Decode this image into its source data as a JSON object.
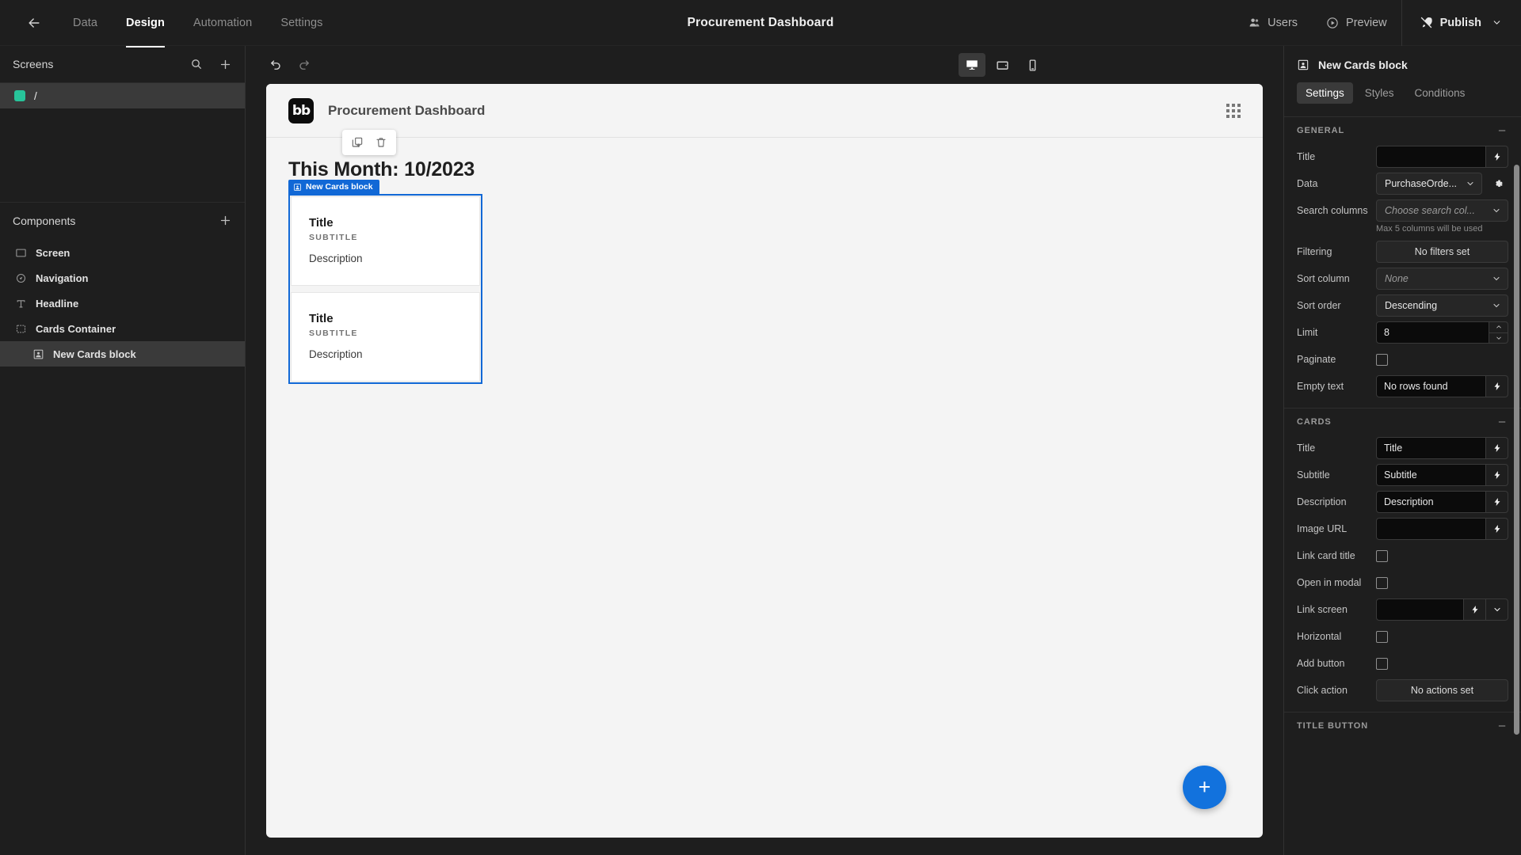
{
  "topbar": {
    "back_icon": "arrow-left-icon",
    "tabs": [
      {
        "label": "Data",
        "active": false
      },
      {
        "label": "Design",
        "active": true
      },
      {
        "label": "Automation",
        "active": false
      },
      {
        "label": "Settings",
        "active": false
      }
    ],
    "title": "Procurement Dashboard",
    "users_label": "Users",
    "preview_label": "Preview",
    "publish_label": "Publish"
  },
  "screens_panel": {
    "title": "Screens",
    "search_icon": "search-icon",
    "add_icon": "plus-icon",
    "items": [
      {
        "label": "/",
        "color": "#27c49a",
        "selected": true
      }
    ]
  },
  "components_panel": {
    "title": "Components",
    "add_icon": "plus-icon",
    "items": [
      {
        "label": "Screen",
        "icon": "screen-icon",
        "indent": false,
        "selected": false
      },
      {
        "label": "Navigation",
        "icon": "navigation-icon",
        "indent": false,
        "selected": false
      },
      {
        "label": "Headline",
        "icon": "text-icon",
        "indent": false,
        "selected": false
      },
      {
        "label": "Cards Container",
        "icon": "container-icon",
        "indent": false,
        "selected": false
      },
      {
        "label": "New Cards block",
        "icon": "cards-icon",
        "indent": true,
        "selected": true
      }
    ]
  },
  "canvas_toolbar": {
    "undo_icon": "undo-icon",
    "redo_icon": "redo-icon",
    "devices": [
      {
        "name": "desktop",
        "active": true
      },
      {
        "name": "tablet",
        "active": false
      },
      {
        "name": "mobile",
        "active": false
      }
    ]
  },
  "canvas": {
    "logo_text": "bb",
    "app_title": "Procurement Dashboard",
    "grid_icon": "grid-icon",
    "headline": "This Month: 10/2023",
    "float_toolbar": [
      {
        "name": "duplicate-icon"
      },
      {
        "name": "delete-icon"
      }
    ],
    "selection_label": "New Cards block",
    "selection_color": "#1168d6",
    "cards": [
      {
        "title": "Title",
        "subtitle": "SUBTITLE",
        "description": "Description"
      },
      {
        "title": "Title",
        "subtitle": "SUBTITLE",
        "description": "Description"
      }
    ],
    "fab_icon": "plus-icon",
    "fab_color": "#1272dd"
  },
  "settings_panel": {
    "component_name": "New Cards block",
    "component_icon": "cards-icon",
    "tabs": [
      {
        "label": "Settings",
        "active": true
      },
      {
        "label": "Styles",
        "active": false
      },
      {
        "label": "Conditions",
        "active": false
      }
    ],
    "general": {
      "heading": "GENERAL",
      "title_label": "Title",
      "title_value": "",
      "data_label": "Data",
      "data_value": "PurchaseOrde...",
      "search_columns_label": "Search columns",
      "search_columns_placeholder": "Choose search col...",
      "search_columns_helper": "Max 5 columns will be used",
      "filtering_label": "Filtering",
      "filtering_value": "No filters set",
      "sort_column_label": "Sort column",
      "sort_column_value": "None",
      "sort_order_label": "Sort order",
      "sort_order_value": "Descending",
      "limit_label": "Limit",
      "limit_value": "8",
      "paginate_label": "Paginate",
      "paginate_checked": false,
      "empty_text_label": "Empty text",
      "empty_text_value": "No rows found"
    },
    "cards": {
      "heading": "CARDS",
      "title_label": "Title",
      "title_value": "Title",
      "subtitle_label": "Subtitle",
      "subtitle_value": "Subtitle",
      "description_label": "Description",
      "description_value": "Description",
      "image_url_label": "Image URL",
      "image_url_value": "",
      "link_card_title_label": "Link card title",
      "link_card_title_checked": false,
      "open_in_modal_label": "Open in modal",
      "open_in_modal_checked": false,
      "link_screen_label": "Link screen",
      "link_screen_value": "",
      "horizontal_label": "Horizontal",
      "horizontal_checked": false,
      "add_button_label": "Add button",
      "add_button_checked": false,
      "click_action_label": "Click action",
      "click_action_value": "No actions set"
    },
    "title_button": {
      "heading": "TITLE BUTTON"
    }
  }
}
